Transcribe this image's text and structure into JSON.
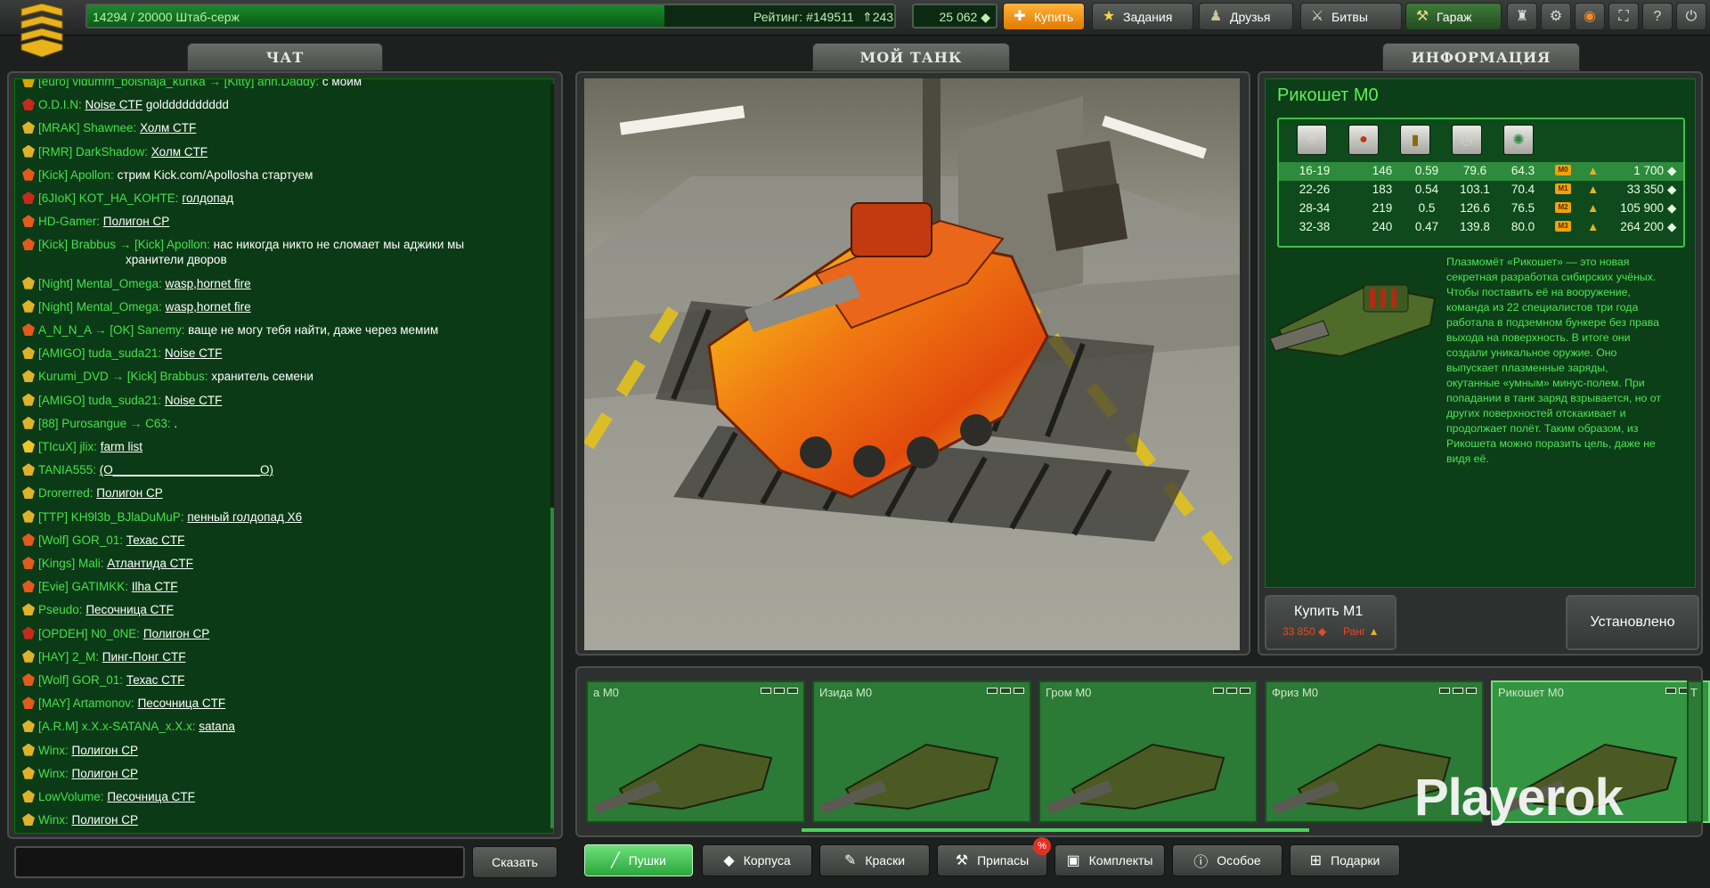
{
  "topbar": {
    "xp_text": "14294 / 20000 Штаб-серж",
    "rating_text": "Рейтинг: #149511",
    "rating_delta": "⇑243",
    "crystals": "25 062",
    "xp_progress": 0.715,
    "buttons": {
      "buy": "Купить",
      "missions": "Задания",
      "friends": "Друзья",
      "battles": "Битвы",
      "garage": "Гараж"
    }
  },
  "sections": {
    "chat": "ЧАТ",
    "my_tank": "МОЙ ТАНК",
    "info": "ИНФОРМАЦИЯ"
  },
  "chat": {
    "say_button": "Сказать",
    "lines": [
      {
        "user": "[euro] vidumm_bolshaja_kurtka → [Kitty] ann.Daddy:",
        "msg": "с моим",
        "link": false,
        "badge": "#d7a400"
      },
      {
        "user": "O.D.I.N:",
        "msg": "Noise CTF",
        "msg2": "goldddddddddd",
        "link": true,
        "badge": "#c72a1b"
      },
      {
        "user": "[MRAK] Shawnee:",
        "msg": "Холм CTF",
        "link": true,
        "badge": "#e0b22a"
      },
      {
        "user": "[RMR] DarkShadow:",
        "msg": "Холм CTF",
        "link": true,
        "badge": "#e0b22a"
      },
      {
        "user": "[Kick] Apollon:",
        "msg": "стрим Kick.com/Apollosha стартуем",
        "link": false,
        "badge": "#e35a1b"
      },
      {
        "user": "[6JIoK] KOT_HA_KOHTE:",
        "msg": "голдопад",
        "link": true,
        "badge": "#c72a1b"
      },
      {
        "user": "HD-Gamer:",
        "msg": "Полигон CP",
        "link": true,
        "badge": "#e35a1b"
      },
      {
        "user": "[Kick] Brabbus → [Kick] Apollon:",
        "msg": "нас никогда никто не сломает мы аджики мы",
        "msg2line": "хранители дворов",
        "link": false,
        "badge": "#e35a1b"
      },
      {
        "user": "[Night] Mental_Omega:",
        "msg": "wasp,hornet fire",
        "link": true,
        "badge": "#e0b22a"
      },
      {
        "user": "[Night] Mental_Omega:",
        "msg": "wasp,hornet fire",
        "link": true,
        "badge": "#e0b22a"
      },
      {
        "user": "A_N_N_A → [OK] Sanemy:",
        "msg": "ваще не могу тебя найти, даже через мемим",
        "link": false,
        "badge": "#e35a1b"
      },
      {
        "user": "[AMIGO] tuda_suda21:",
        "msg": "Noise CTF",
        "link": true,
        "badge": "#e0b22a"
      },
      {
        "user": "Kurumi_DVD → [Kick] Brabbus:",
        "msg": "хранитель семени",
        "link": false,
        "badge": "#e0b22a"
      },
      {
        "user": "[AMIGO] tuda_suda21:",
        "msg": "Noise CTF",
        "link": true,
        "badge": "#e0b22a"
      },
      {
        "user": "[88] Purosangue → C63:",
        "msg": ".",
        "link": false,
        "badge": "#e0b22a"
      },
      {
        "user": "[TIcuX] jlix:",
        "msg": "farm list",
        "link": true,
        "badge": "#f0c52a"
      },
      {
        "user": "TANIA555:",
        "msg": "(O______________________O)",
        "link": true,
        "badge": "#e0b22a"
      },
      {
        "user": "Drorerred:",
        "msg": "Полигон CP",
        "link": true,
        "badge": "#e0b22a"
      },
      {
        "user": "[TTP] KH9l3b_BJlaDuMuP:",
        "msg": "пенный голдопад Х6",
        "link": true,
        "badge": "#e0b22a"
      },
      {
        "user": "[Wolf] GOR_01:",
        "msg": "Техас CTF",
        "link": true,
        "badge": "#e35a1b"
      },
      {
        "user": "[Kings] Mali:",
        "msg": "Атлантида CTF",
        "link": true,
        "badge": "#e35a1b"
      },
      {
        "user": "[Evie] GATIMKK:",
        "msg": "Ilha CTF",
        "link": true,
        "badge": "#e35a1b"
      },
      {
        "user": "Pseudo:",
        "msg": "Песочница CTF",
        "link": true,
        "badge": "#e0b22a"
      },
      {
        "user": "[OPDEH] N0_0NE:",
        "msg": "Полигон CP",
        "link": true,
        "badge": "#c72a1b"
      },
      {
        "user": "[HAY] 2_M:",
        "msg": "Пинг-Понг CTF",
        "link": true,
        "badge": "#e0b22a"
      },
      {
        "user": "[Wolf] GOR_01:",
        "msg": "Техас CTF",
        "link": true,
        "badge": "#e35a1b"
      },
      {
        "user": "[MAY] Artamonov:",
        "msg": "Песочница CTF",
        "link": true,
        "badge": "#e35a1b"
      },
      {
        "user": "[A.R.M] x.X.x-SATANA_x.X.x:",
        "msg": "satana",
        "link": true,
        "badge": "#e0b22a"
      },
      {
        "user": "Winx:",
        "msg": "Полигон CP",
        "link": true,
        "badge": "#e0b22a"
      },
      {
        "user": "Winx:",
        "msg": "Полигон CP",
        "link": true,
        "badge": "#e0b22a"
      },
      {
        "user": "LowVolume:",
        "msg": "Песочница CTF",
        "link": true,
        "badge": "#e0b22a"
      },
      {
        "user": "Winx:",
        "msg": "Полигон CP",
        "link": true,
        "badge": "#e0b22a"
      }
    ]
  },
  "info": {
    "title": "Рикошет M0",
    "stat_icons": [
      "shield-icon",
      "damage-icon",
      "ammo-icon",
      "reload-icon",
      "range-icon"
    ],
    "rows": [
      {
        "range": "16-19",
        "a": "146",
        "b": "0.59",
        "c": "79.6",
        "d": "64.3",
        "mod": "M0",
        "price": "1 700",
        "selected": true
      },
      {
        "range": "22-26",
        "a": "183",
        "b": "0.54",
        "c": "103.1",
        "d": "70.4",
        "mod": "M1",
        "price": "33 350",
        "selected": false
      },
      {
        "range": "28-34",
        "a": "219",
        "b": "0.5",
        "c": "126.6",
        "d": "76.5",
        "mod": "M2",
        "price": "105 900",
        "selected": false
      },
      {
        "range": "32-38",
        "a": "240",
        "b": "0.47",
        "c": "139.8",
        "d": "80.0",
        "mod": "M3",
        "price": "264 200",
        "selected": false
      }
    ],
    "description": "Плазмомёт «Рикошет» — это новая секретная разработка сибирских учёных. Чтобы поставить её на вооружение, команда из 22 специалистов три года работала в подземном бункере без права выхода на поверхность. В итоге они создали уникальное оружие. Оно выпускает плазменные заряды, окутанные «умным» минус-полем. При попадании в танк заряд взрывается, но от других поверхностей отскакивает и продолжает полёт. Таким образом, из Рикошета можно поразить цель, даже не видя её.",
    "buy_label": "Купить M1",
    "buy_price": "33 850",
    "buy_rank": "Ранг",
    "installed_label": "Установлено"
  },
  "garage": {
    "items": [
      {
        "name": "а M0",
        "selected": false
      },
      {
        "name": "Изида M0",
        "selected": false
      },
      {
        "name": "Гром M0",
        "selected": false
      },
      {
        "name": "Фриз M0",
        "selected": false
      },
      {
        "name": "Рикошет M0",
        "selected": true
      }
    ],
    "right_tab_label": "T"
  },
  "bottom_tabs": {
    "guns": "Пушки",
    "hulls": "Корпуса",
    "paints": "Краски",
    "supplies": "Припасы",
    "kits": "Комплекты",
    "special": "Особое",
    "gifts": "Подарки"
  },
  "watermark": "Playerok",
  "colors": {
    "chat_bg": "#0b3b16",
    "chat_name": "#46e04d",
    "accent_green": "#2aa63c",
    "buy_orange": "#f0940a",
    "price_red": "#e34a2a"
  }
}
